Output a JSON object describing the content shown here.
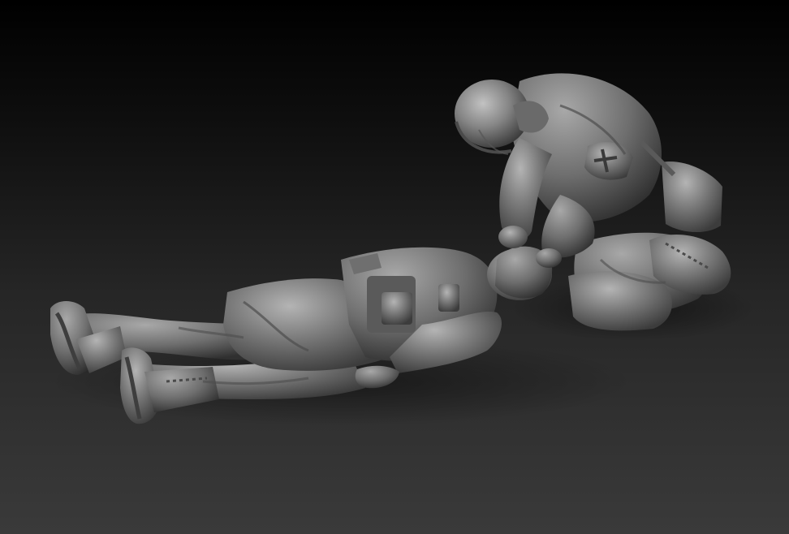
{
  "scene": {
    "background_top_color": "#000000",
    "background_bottom_color": "#3a3a3a",
    "sculpt_color": "#8a8a8a",
    "figures": [
      "medic-figure",
      "wounded-soldier-figure"
    ]
  }
}
